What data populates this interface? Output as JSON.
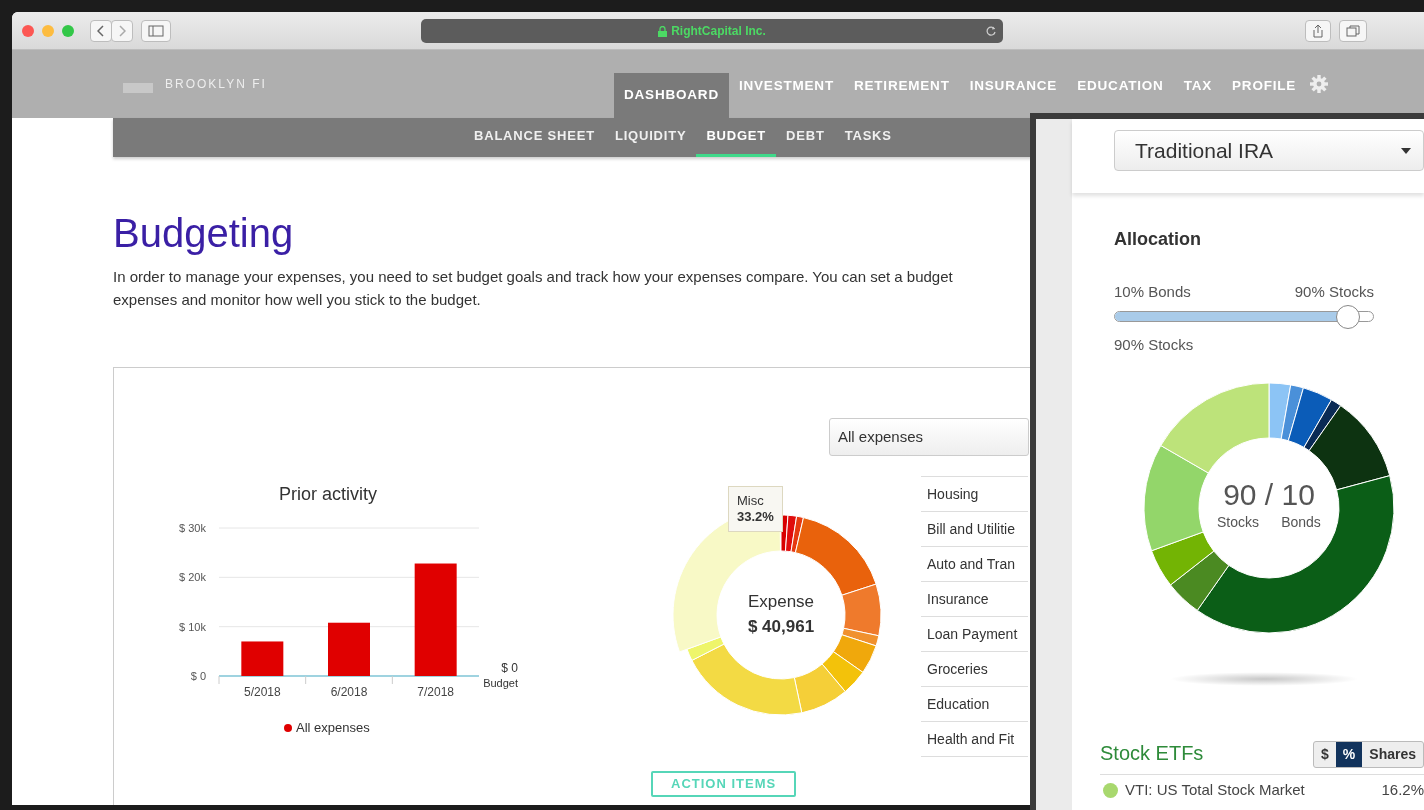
{
  "browser": {
    "address": "RightCapital Inc."
  },
  "brand": "BROOKLYN FI",
  "nav": [
    {
      "label": "DASHBOARD",
      "selected": true
    },
    {
      "label": "INVESTMENT",
      "selected": false
    },
    {
      "label": "RETIREMENT",
      "selected": false
    },
    {
      "label": "INSURANCE",
      "selected": false
    },
    {
      "label": "EDUCATION",
      "selected": false
    },
    {
      "label": "TAX",
      "selected": false
    },
    {
      "label": "PROFILE",
      "selected": false
    }
  ],
  "subnav": [
    {
      "label": "BALANCE SHEET",
      "selected": false
    },
    {
      "label": "LIQUIDITY",
      "selected": false
    },
    {
      "label": "BUDGET",
      "selected": true
    },
    {
      "label": "DEBT",
      "selected": false
    },
    {
      "label": "TASKS",
      "selected": false
    }
  ],
  "page": {
    "title": "Budgeting",
    "description": [
      "In order to manage your expenses, you need to set budget goals and track how your expenses compare. You can set a budget",
      "expenses and monitor how well you stick to the budget."
    ]
  },
  "prior_activity": {
    "chart_data": {
      "type": "bar",
      "title": "Prior activity",
      "categories": [
        "5/2018",
        "6/2018",
        "7/2018"
      ],
      "series": [
        {
          "name": "All expenses",
          "color": "#e00000",
          "values": [
            7000,
            10800,
            22800
          ]
        }
      ],
      "ylim": [
        0,
        30000
      ],
      "yticks": [
        {
          "value": 0,
          "label": "$ 0"
        },
        {
          "value": 10000,
          "label": "$ 10k"
        },
        {
          "value": 20000,
          "label": "$ 20k"
        },
        {
          "value": 30000,
          "label": "$ 30k"
        }
      ],
      "annotations": [
        {
          "text": "$ 0"
        },
        {
          "text": "Budget"
        }
      ]
    }
  },
  "expense_filter": {
    "value": "All expenses"
  },
  "expense_donut": {
    "label": "Expense",
    "total": "$ 40,961",
    "tooltip": {
      "name": "Misc",
      "share": "33.2%"
    }
  },
  "categories": [
    "Housing",
    "Bill and Utilitie",
    "Auto and Tran",
    "Insurance",
    "Loan Payment",
    "Groceries",
    "Education",
    "Health and Fit"
  ],
  "action_button": "ACTION ITEMS",
  "panel": {
    "account": "Traditional IRA",
    "allocation": {
      "title": "Allocation",
      "left_label": "10% Bonds",
      "right_label": "90% Stocks",
      "level": 0.9,
      "reading": "90% Stocks"
    },
    "donut": {
      "ratio": "90 / 10",
      "left": "Stocks",
      "right": "Bonds"
    },
    "etfs": {
      "title": "Stock ETFs",
      "units": [
        {
          "label": "$",
          "selected": false
        },
        {
          "label": "%",
          "selected": true
        },
        {
          "label": "Shares",
          "selected": false
        }
      ],
      "rows": [
        {
          "name": "VTI: US Total Stock Market",
          "value": "16.2%",
          "color": "#a8d86e"
        }
      ]
    }
  }
}
